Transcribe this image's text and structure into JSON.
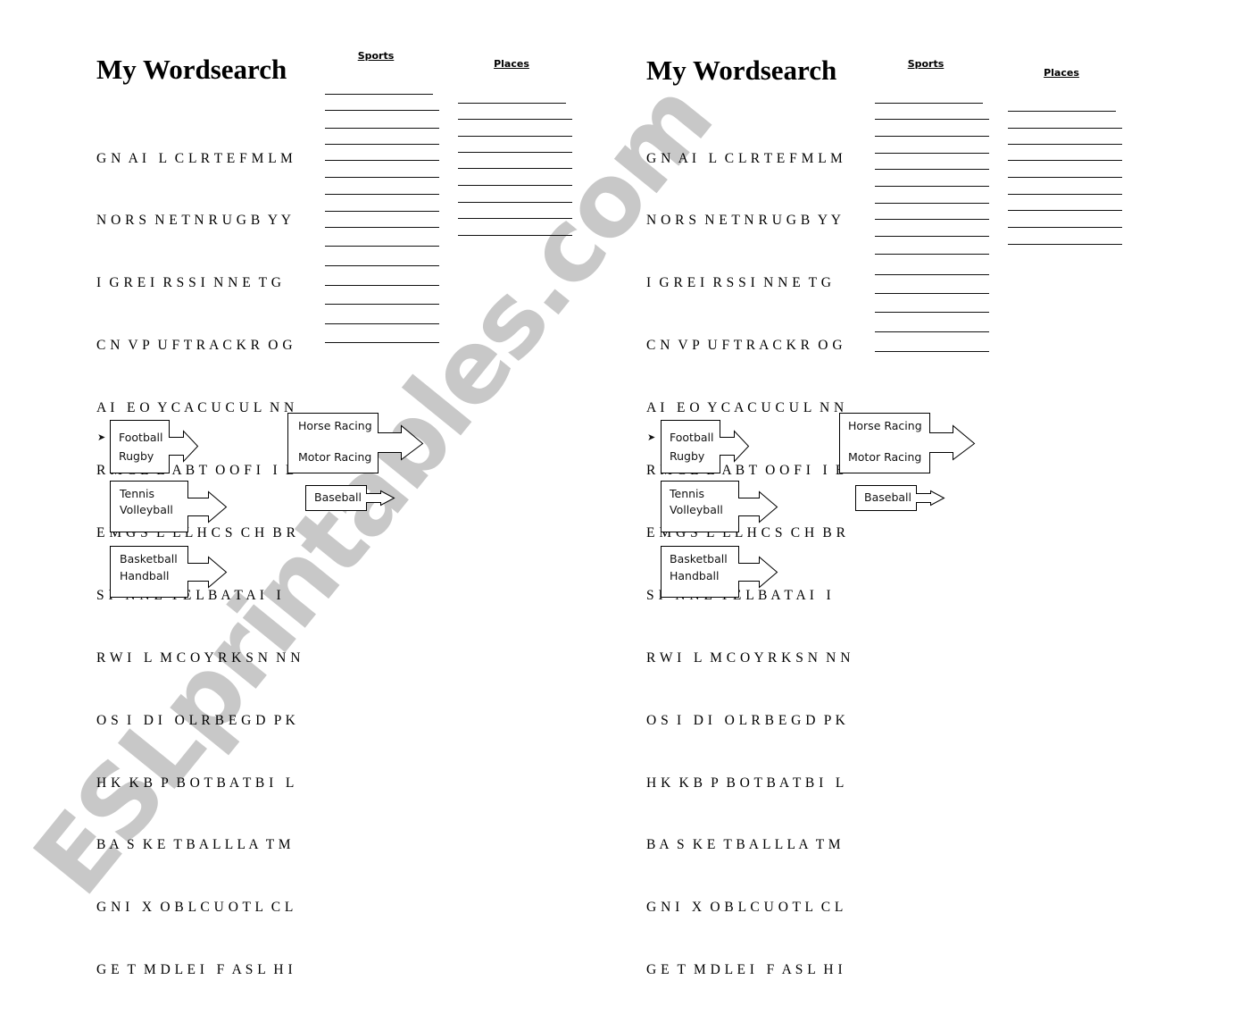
{
  "worksheet": {
    "title": "My Wordsearch",
    "sports_header": "Sports",
    "places_header": "Places",
    "grid_rows": [
      "GN AI L CLRTEFMLM",
      "NORSNETNRUGBYY",
      "I GREI RSSI NNETG",
      "CNVPUFTRACKROG",
      "AI EOYCACUCULNN",
      "RMCLLABTOOFI I B",
      "EMGSLLLHCSCHBR",
      "SI NNETELBATAI I",
      "RWI LMCOYRKSNNN",
      "OSI DI OLRBEGDPK",
      "HKKBPBOTBATBI L",
      "BASKETBALLLATM",
      "GNI XOBLCUOTLCL",
      "GETMDLEI FASLHI"
    ],
    "grid_rows_display": [
      "G N  A I   L  C L R T E F M L M",
      "N O R S  N E T N R U G B  Y Y",
      "I  G R E I  R S S I  N N E  T G",
      "C N  V P  U F T R A C K R  O G",
      "A I   E O  Y C A C U C U L  N N",
      "R M C L  L  A B T  O O F I   I  B",
      "E M G S  L  L L H C S  C H  B R",
      "S I   N N E  T E L B A T A I   I",
      "R W I   L  M C O Y R K S N  N N",
      "O S  I   D I   O L R B E G D  P K",
      "H K  K B  P  B O T B A T B I   L",
      "B A  S  K E  T B A L L L A  T M",
      "G N I   X  O B L C U O T L  C L",
      "G E  T  M D L E I   F  A S L  H I"
    ],
    "sports_line_count": 15,
    "places_line_count": 9,
    "hint_boxes": [
      {
        "lines": [
          "Football",
          "Rugby"
        ],
        "bullet": "➤"
      },
      {
        "lines": [
          "Tennis",
          "Volleyball"
        ]
      },
      {
        "lines": [
          "Basketball",
          "Handball"
        ]
      },
      {
        "lines": [
          "Horse Racing",
          "Motor Racing"
        ]
      },
      {
        "lines": [
          "Baseball"
        ]
      }
    ],
    "icons": {
      "bullet": "arrowhead-bullet-icon",
      "box_arrow": "block-arrow-right-icon"
    }
  },
  "watermark": "ESLprintables.com",
  "colors": {
    "watermark": "#c6c6c6",
    "text": "#000000",
    "background": "#ffffff"
  }
}
